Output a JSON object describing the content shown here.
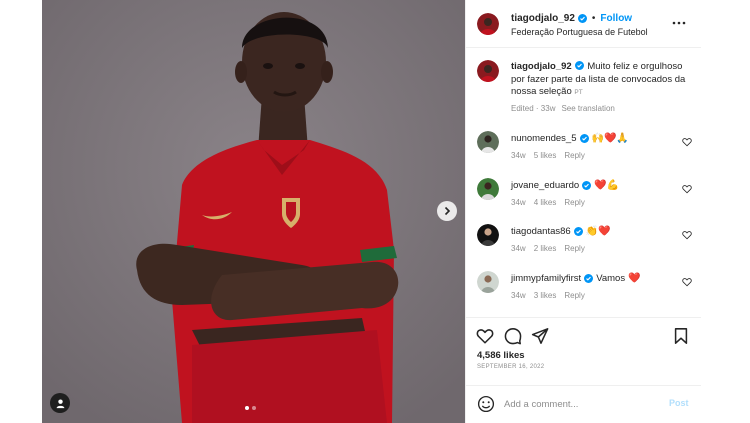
{
  "colors": {
    "accent": "#0095f6",
    "heart": "#ed4956",
    "jersey": "#c8102e",
    "backdrop": "#7d767b"
  },
  "header": {
    "username": "tiagodjalo_92",
    "bullet": "•",
    "follow_label": "Follow",
    "subtitle": "Federação Portuguesa de Futebol"
  },
  "caption": {
    "username": "tiagodjalo_92",
    "text": " Muito feliz e orgulhoso por fazer parte da lista de convocados da nossa seleção ",
    "flag_label": "PT",
    "edited": "Edited · 33w",
    "see_translation": "See translation"
  },
  "comments": [
    {
      "username": "nunomendes_5",
      "emoji": "🙌❤️🙏",
      "age": "34w",
      "likes": "5 likes",
      "reply": "Reply"
    },
    {
      "username": "jovane_eduardo",
      "emoji": "❤️💪",
      "age": "34w",
      "likes": "4 likes",
      "reply": "Reply"
    },
    {
      "username": "tiagodantas86",
      "emoji": "👏❤️",
      "age": "34w",
      "likes": "2 likes",
      "reply": "Reply"
    },
    {
      "username": "jimmypfamilyfirst",
      "text": "Vamos",
      "emoji": "❤️",
      "age": "34w",
      "likes": "3 likes",
      "reply": "Reply"
    }
  ],
  "post": {
    "likes": "4,586 likes",
    "date": "SEPTEMBER 16, 2022"
  },
  "comment_box": {
    "placeholder": "Add a comment...",
    "post_label": "Post"
  }
}
